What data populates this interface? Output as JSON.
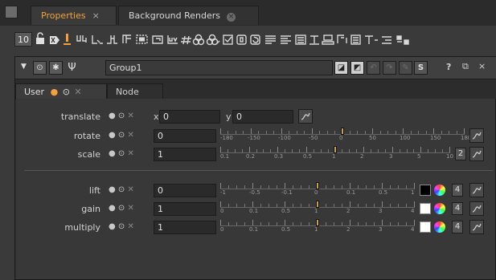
{
  "tabs": [
    {
      "label": "Properties",
      "close": "×"
    },
    {
      "label": "Background Renders",
      "close": "×"
    }
  ],
  "toolbar": {
    "max_panels": "10",
    "icons": [
      "lock-icon",
      "clear-panels-icon",
      "float-panel-icon",
      "node-graph-icon",
      "link-icon",
      "join-icon",
      "branch-icon",
      "frame-icon",
      "crop-icon",
      "uv-icon",
      "hash-icon",
      "blend-icon",
      "blend-alt-icon",
      "checkbox-icon",
      "format-icon",
      "reload-icon",
      "list-icon",
      "list-alt-icon",
      "table-icon",
      "text-icon",
      "print-icon",
      "merge-icon",
      "menu-icon",
      "type-icon",
      "spacer-icon",
      "divider-icon"
    ]
  },
  "node": {
    "name": "Group1",
    "header_right": [
      "?",
      "⧉",
      "×"
    ],
    "s_label": "S"
  },
  "subtabs": {
    "user": "User",
    "node": "Node"
  },
  "knobs": [
    {
      "label": "translate",
      "x_label": "x",
      "x": "0",
      "y_label": "y",
      "y": "0"
    },
    {
      "label": "rotate",
      "value": "0",
      "slider_labels": [
        "-180",
        "-150",
        "-100",
        "-50",
        "0",
        "50",
        "100",
        "150",
        "180"
      ],
      "slider_value": 0.5
    },
    {
      "label": "scale",
      "value": "1",
      "slider_labels": [
        "0.1",
        "0.2",
        "0.3",
        "0.5",
        "1",
        "2",
        "3",
        "5",
        "10"
      ],
      "count": "2",
      "slider_value": 0.5
    },
    {
      "label": "lift",
      "value": "0",
      "slider_labels": [
        "-1",
        "-0.5",
        "-0.1",
        "0",
        "0.1",
        "0.5",
        "1"
      ],
      "count": "4",
      "swatch": "#000000",
      "slider_value": 0.5
    },
    {
      "label": "gain",
      "value": "1",
      "slider_labels": [
        "0",
        "0.1",
        "0.5",
        "1",
        "2",
        "3",
        "4"
      ],
      "count": "4",
      "swatch": "#ffffff",
      "slider_value": 0.5
    },
    {
      "label": "multiply",
      "value": "1",
      "slider_labels": [
        "0",
        "0.1",
        "0.5",
        "1",
        "2",
        "3",
        "4"
      ],
      "count": "4",
      "swatch": "#ffffff",
      "slider_value": 0.5
    }
  ],
  "colors": {
    "accent": "#f5a03a",
    "handle": "#c9a24d"
  }
}
